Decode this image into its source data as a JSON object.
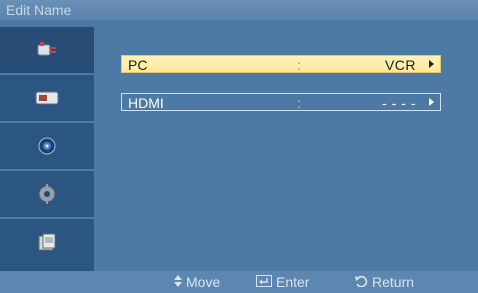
{
  "window": {
    "title": "Edit Name"
  },
  "sidebar": {
    "items": [
      {
        "icon": "input-plug-icon",
        "selected": true
      },
      {
        "icon": "picture-icon",
        "selected": false
      },
      {
        "icon": "sound-icon",
        "selected": false
      },
      {
        "icon": "setup-gear-icon",
        "selected": false
      },
      {
        "icon": "multi-control-icon",
        "selected": false
      }
    ]
  },
  "rows": [
    {
      "label": "PC",
      "separator": ":",
      "value": "VCR"
    },
    {
      "label": "HDMI",
      "separator": ":",
      "value": "- - - -"
    }
  ],
  "footer": {
    "move": "Move",
    "enter": "Enter",
    "return": "Return"
  },
  "colors": {
    "background": "#4c78a4",
    "sidebar": "#2b5682",
    "highlight": "#ffeeaa",
    "text": "#ffffff"
  }
}
